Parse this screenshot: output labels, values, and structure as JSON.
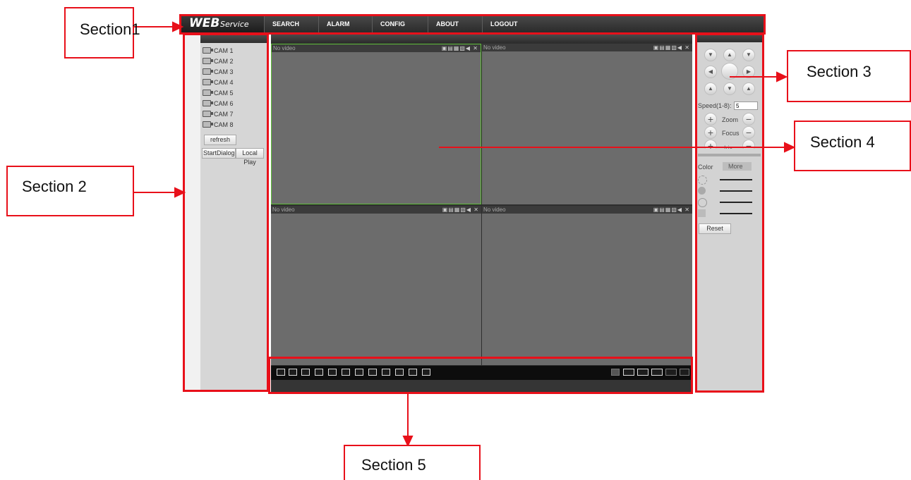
{
  "app": {
    "logo_main": "WEB",
    "logo_sub": "Service",
    "menu": [
      "SEARCH",
      "ALARM",
      "CONFIG",
      "ABOUT",
      "LOGOUT"
    ]
  },
  "left_panel": {
    "cameras": [
      "CAM 1",
      "CAM 2",
      "CAM 3",
      "CAM 4",
      "CAM 5",
      "CAM 6",
      "CAM 7",
      "CAM 8"
    ],
    "refresh_label": "refresh",
    "start_dialog_label": "StartDialog",
    "local_play_label": "Local Play"
  },
  "video": {
    "no_video_label": "No video",
    "tile_icons": "▣▤▦▧◀ ✕"
  },
  "ptz": {
    "speed_label": "Speed(1-8):",
    "speed_value": "5",
    "zoom_label": "Zoom",
    "focus_label": "Focus",
    "iris_label": "Iris",
    "plus": "+",
    "minus": "−",
    "tab_color": "Color",
    "tab_more": "More",
    "reset_label": "Reset"
  },
  "callouts": {
    "section1": "Section1",
    "section2": "Section 2",
    "section3": "Section 3",
    "section4": "Section 4",
    "section5": "Section 5"
  },
  "colors": {
    "annotation_red": "#e8101a",
    "selected_tile_border": "#5fbf3a"
  }
}
